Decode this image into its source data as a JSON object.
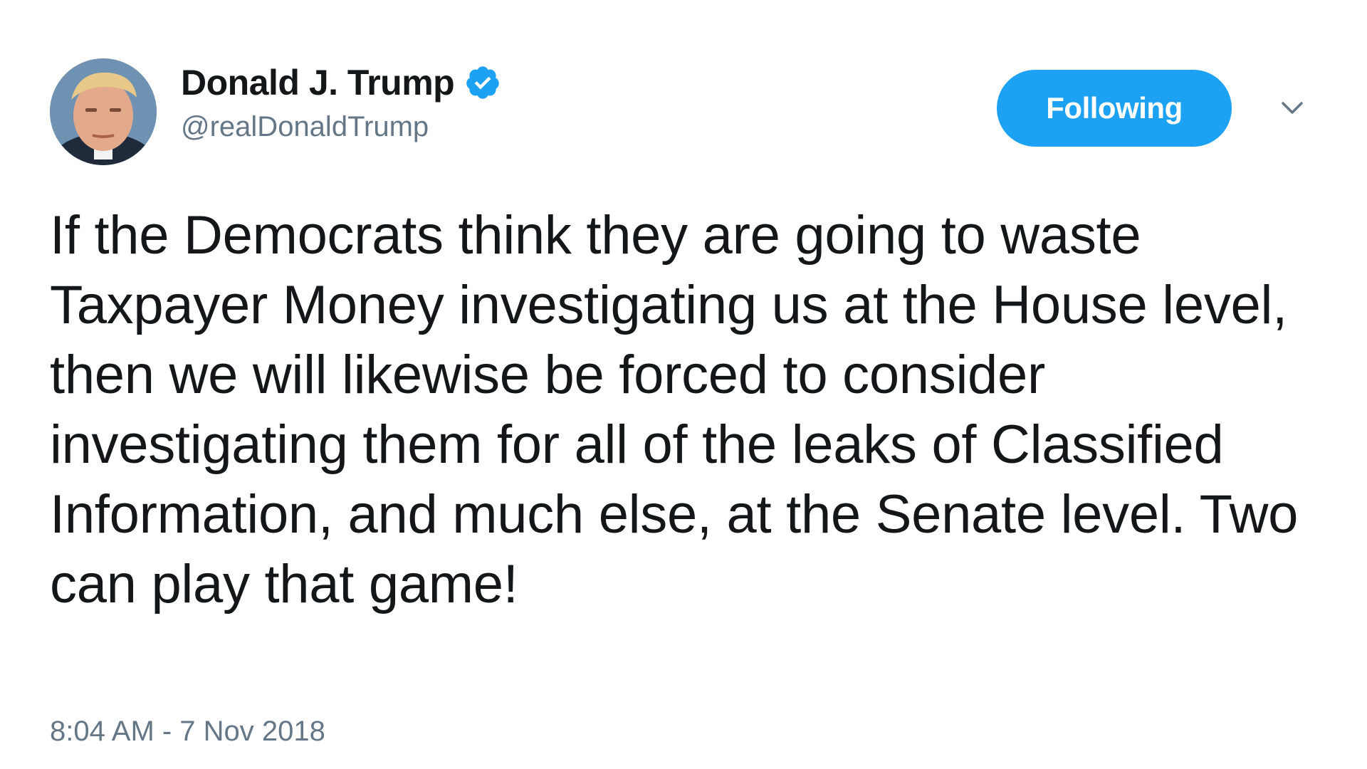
{
  "author": {
    "display_name": "Donald J. Trump",
    "handle": "@realDonaldTrump",
    "verified_icon": "verified-badge-icon",
    "avatar_icon": "profile-photo"
  },
  "actions": {
    "follow_label": "Following",
    "menu_icon": "chevron-down-icon"
  },
  "tweet": {
    "text": "If the Democrats think they are going to waste Taxpayer Money investigating us at the House level, then we will likewise be forced to consider investigating them for all of the leaks of Classified Information, and much else, at the Senate level. Two can play that game!",
    "timestamp": "8:04 AM - 7 Nov 2018"
  },
  "colors": {
    "brand_blue": "#1da1f2",
    "text_primary": "#14171a",
    "text_secondary": "#657786"
  }
}
